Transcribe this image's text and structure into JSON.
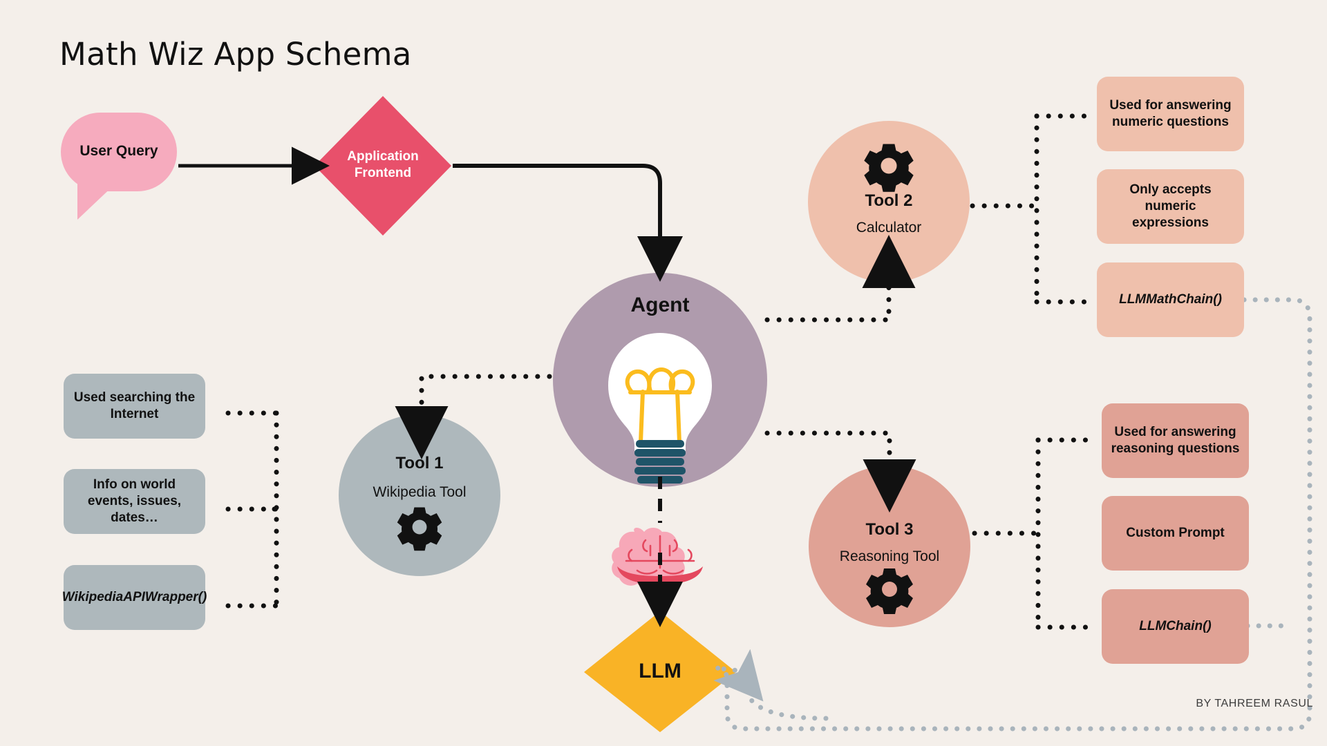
{
  "page": {
    "title": "Math Wiz App Schema",
    "byline": "BY TAHREEM RASUL",
    "background": "#F4EFEA"
  },
  "colors": {
    "background": "#F4EFEA",
    "user_query_pink": "#F6ABBE",
    "frontend_crimson": "#E8506B",
    "agent_purple": "#AF9BAD",
    "tool1_gray": "#AEB8BC",
    "tool2_peach": "#EFC0AC",
    "tool3_salmon": "#E0A295",
    "llm_yellow": "#F9B326",
    "bulb_filament": "#FBBC1E",
    "bulb_base": "#1F5468",
    "brain_pink": "#F7A8B8",
    "brain_line": "#E4485E",
    "dotted_black": "#111111",
    "dotted_gray": "#A9B4BC",
    "text_dark": "#111111",
    "text_light": "#FFFFFF"
  },
  "nodes": {
    "user_query": {
      "label": "User Query",
      "shape": "speech-bubble"
    },
    "application_frontend": {
      "label_line1": "Application",
      "label_line2": "Frontend",
      "shape": "diamond"
    },
    "agent": {
      "label": "Agent",
      "icon": "lightbulb-icon",
      "shape": "circle"
    },
    "llm": {
      "label": "LLM",
      "icon": "brain-icon",
      "shape": "diamond"
    },
    "tool1": {
      "title": "Tool 1",
      "subtitle": "Wikipedia Tool",
      "icon": "gear-icon",
      "shape": "circle"
    },
    "tool2": {
      "title": "Tool 2",
      "subtitle": "Calculator",
      "icon": "gear-icon",
      "shape": "circle"
    },
    "tool3": {
      "title": "Tool 3",
      "subtitle": "Reasoning Tool",
      "icon": "gear-icon",
      "shape": "circle"
    }
  },
  "tool1_notes": [
    {
      "text": "Used searching the Internet",
      "italic": false
    },
    {
      "text": "Info on world events, issues, dates…",
      "italic": false
    },
    {
      "text": "WikipediaAPIWrapper()",
      "italic": true
    }
  ],
  "tool2_notes": [
    {
      "text": "Used for answering numeric questions",
      "italic": false
    },
    {
      "text": "Only accepts numeric expressions",
      "italic": false
    },
    {
      "text": "LLMMathChain()",
      "italic": true
    }
  ],
  "tool3_notes": [
    {
      "text": "Used for answering reasoning questions",
      "italic": false
    },
    {
      "text": "Custom Prompt",
      "italic": false
    },
    {
      "text": "LLMChain()",
      "italic": true
    }
  ],
  "edges": [
    {
      "from": "user_query",
      "to": "application_frontend",
      "style": "solid-arrow"
    },
    {
      "from": "application_frontend",
      "to": "agent",
      "style": "solid-elbow-arrow"
    },
    {
      "from": "agent",
      "to": "tool1",
      "style": "dotted-elbow-arrow"
    },
    {
      "from": "agent",
      "to": "tool2",
      "style": "dotted-elbow-arrow"
    },
    {
      "from": "agent",
      "to": "tool3",
      "style": "dotted-elbow-arrow"
    },
    {
      "from": "agent",
      "to": "llm",
      "style": "dashed-arrow"
    },
    {
      "from": "tool1",
      "to": "tool1_notes",
      "style": "dotted-tree"
    },
    {
      "from": "tool2",
      "to": "tool2_notes",
      "style": "dotted-tree"
    },
    {
      "from": "tool3",
      "to": "tool3_notes",
      "style": "dotted-tree"
    },
    {
      "from": "LLMMathChain()",
      "to": "llm",
      "style": "dotted-gray-curve-arrow"
    },
    {
      "from": "LLMChain()",
      "to": "llm",
      "style": "dotted-gray-curve-arrow"
    }
  ]
}
